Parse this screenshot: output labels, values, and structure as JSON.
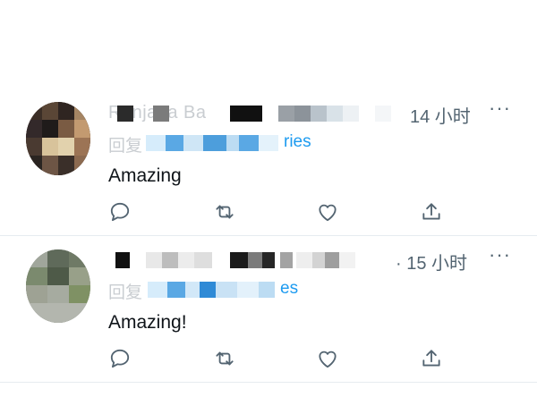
{
  "colors": {
    "text_primary": "#0f1419",
    "text_secondary": "#536471",
    "link": "#1d9bf0",
    "divider": "#e6ecf0"
  },
  "tweets": [
    {
      "author_name": "Ranjana Ba",
      "time": "14 小时",
      "more": "···",
      "reply_prefix": "回复",
      "reply_tail": "ries",
      "text": "Amazing",
      "actions": [
        "reply-icon",
        "retweet-icon",
        "like-icon",
        "share-icon"
      ]
    },
    {
      "author_name": "",
      "time": "· 15 小时",
      "more": "···",
      "reply_prefix": "回复",
      "reply_tail": "es",
      "text": "Amazing!",
      "actions": [
        "reply-icon",
        "retweet-icon",
        "like-icon",
        "share-icon"
      ]
    }
  ]
}
